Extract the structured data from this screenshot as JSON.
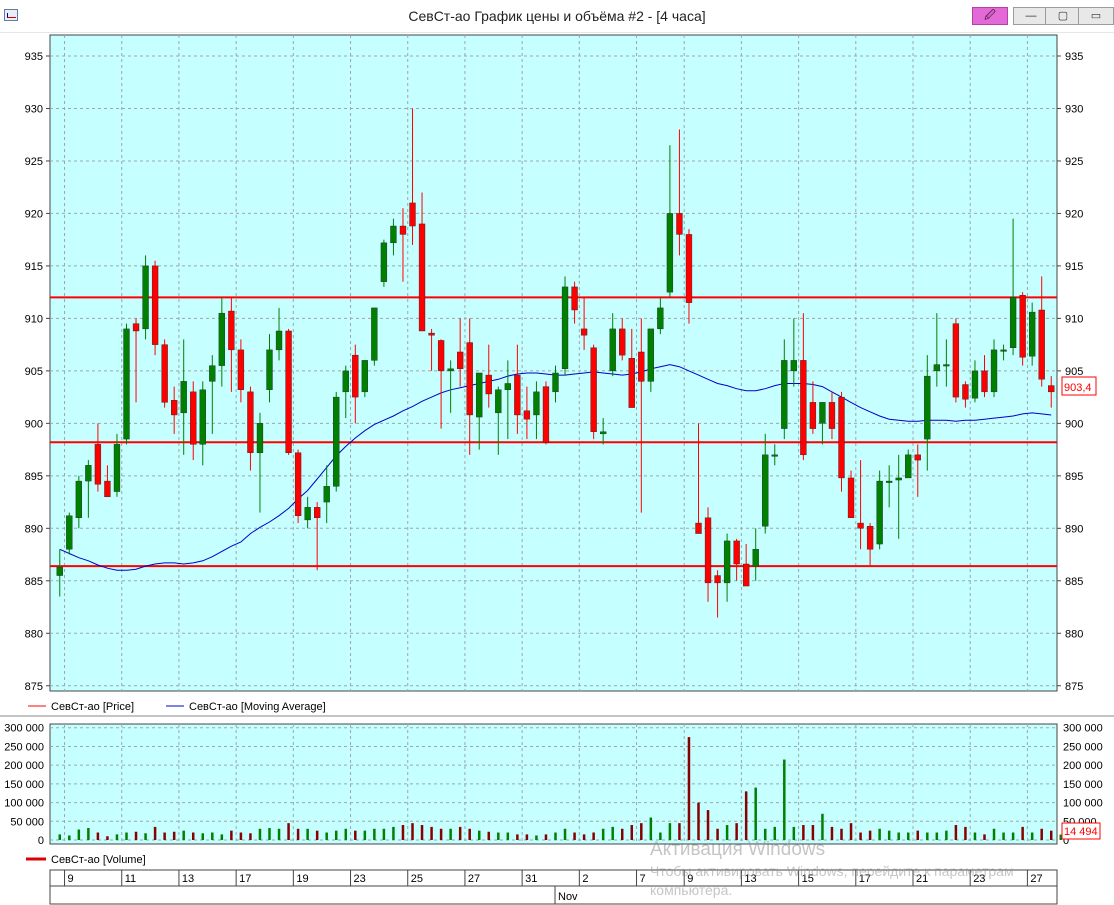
{
  "window": {
    "title": "СевСт-ао График цены и объёма #2 - [4 часа]",
    "buttons": {
      "pin": "🖉",
      "minimize": "—",
      "maximize": "▢",
      "close": "▭"
    }
  },
  "chart_data": [
    {
      "type": "candlestick",
      "series": [
        {
          "name": "СевСт-ао [Price]",
          "color": "#ff0000"
        },
        {
          "name": "СевСт-ао [Moving Average]",
          "color": "#0000cc"
        }
      ],
      "ylim": [
        874.5,
        937
      ],
      "yticks": [
        875,
        880,
        885,
        890,
        895,
        900,
        905,
        910,
        915,
        920,
        925,
        930,
        935
      ],
      "last_value_label": "903,4",
      "horizontal_levels": [
        912.0,
        898.2,
        886.4
      ],
      "candles": [
        {
          "o": 885.5,
          "h": 888.0,
          "l": 883.5,
          "c": 886.3
        },
        {
          "o": 888.0,
          "h": 891.5,
          "l": 887.5,
          "c": 891.2
        },
        {
          "o": 891.0,
          "h": 895.0,
          "l": 890.0,
          "c": 894.5
        },
        {
          "o": 894.5,
          "h": 896.5,
          "l": 891.0,
          "c": 896.0
        },
        {
          "o": 898.0,
          "h": 900.0,
          "l": 893.5,
          "c": 894.2
        },
        {
          "o": 894.5,
          "h": 896.0,
          "l": 893.0,
          "c": 893.0
        },
        {
          "o": 893.5,
          "h": 899.0,
          "l": 893.0,
          "c": 898.0
        },
        {
          "o": 898.5,
          "h": 909.5,
          "l": 898.0,
          "c": 909.0
        },
        {
          "o": 909.5,
          "h": 910.0,
          "l": 902.0,
          "c": 908.8
        },
        {
          "o": 909.0,
          "h": 916.0,
          "l": 908.0,
          "c": 915.0
        },
        {
          "o": 915.0,
          "h": 915.5,
          "l": 906.5,
          "c": 907.5
        },
        {
          "o": 907.5,
          "h": 908.0,
          "l": 901.5,
          "c": 902.0
        },
        {
          "o": 902.2,
          "h": 903.5,
          "l": 899.0,
          "c": 900.8
        },
        {
          "o": 901.0,
          "h": 908.0,
          "l": 897.0,
          "c": 904.0
        },
        {
          "o": 903.0,
          "h": 904.0,
          "l": 896.5,
          "c": 898.0
        },
        {
          "o": 898.0,
          "h": 904.0,
          "l": 896.0,
          "c": 903.2
        },
        {
          "o": 904.0,
          "h": 906.5,
          "l": 899.0,
          "c": 905.5
        },
        {
          "o": 905.5,
          "h": 912.0,
          "l": 903.5,
          "c": 910.5
        },
        {
          "o": 910.7,
          "h": 912.0,
          "l": 903.0,
          "c": 907.0
        },
        {
          "o": 907.0,
          "h": 908.0,
          "l": 902.0,
          "c": 903.2
        },
        {
          "o": 903.0,
          "h": 903.5,
          "l": 895.5,
          "c": 897.2
        },
        {
          "o": 897.2,
          "h": 901.0,
          "l": 891.5,
          "c": 900.0
        },
        {
          "o": 903.2,
          "h": 908.5,
          "l": 902.0,
          "c": 907.0
        },
        {
          "o": 907.0,
          "h": 911.0,
          "l": 906.0,
          "c": 908.8
        },
        {
          "o": 908.8,
          "h": 909.0,
          "l": 897.0,
          "c": 897.2
        },
        {
          "o": 897.2,
          "h": 897.5,
          "l": 890.5,
          "c": 891.2
        },
        {
          "o": 890.8,
          "h": 893.0,
          "l": 890.0,
          "c": 892.0
        },
        {
          "o": 892.0,
          "h": 892.5,
          "l": 886.0,
          "c": 891.0
        },
        {
          "o": 892.5,
          "h": 896.0,
          "l": 890.5,
          "c": 894.0
        },
        {
          "o": 894.0,
          "h": 903.0,
          "l": 893.5,
          "c": 902.5
        },
        {
          "o": 903.0,
          "h": 905.5,
          "l": 900.5,
          "c": 905.0
        },
        {
          "o": 906.5,
          "h": 907.5,
          "l": 900.0,
          "c": 902.5
        },
        {
          "o": 903.0,
          "h": 906.0,
          "l": 902.5,
          "c": 906.0
        },
        {
          "o": 906.0,
          "h": 911.0,
          "l": 905.5,
          "c": 911.0
        },
        {
          "o": 913.5,
          "h": 917.5,
          "l": 913.0,
          "c": 917.2
        },
        {
          "o": 917.2,
          "h": 919.5,
          "l": 916.0,
          "c": 918.8
        },
        {
          "o": 918.8,
          "h": 920.5,
          "l": 913.5,
          "c": 918.0
        },
        {
          "o": 921.0,
          "h": 930.0,
          "l": 917.0,
          "c": 918.8
        },
        {
          "o": 919.0,
          "h": 922.0,
          "l": 909.0,
          "c": 908.8
        },
        {
          "o": 908.6,
          "h": 909.0,
          "l": 905.0,
          "c": 908.4
        },
        {
          "o": 907.9,
          "h": 908.0,
          "l": 899.5,
          "c": 905.0
        },
        {
          "o": 905.0,
          "h": 906.0,
          "l": 901.0,
          "c": 905.2
        },
        {
          "o": 906.8,
          "h": 910.0,
          "l": 903.5,
          "c": 905.2
        },
        {
          "o": 907.7,
          "h": 910.0,
          "l": 897.0,
          "c": 900.8
        },
        {
          "o": 900.6,
          "h": 904.0,
          "l": 897.5,
          "c": 904.8
        },
        {
          "o": 904.6,
          "h": 907.5,
          "l": 901.5,
          "c": 902.8
        },
        {
          "o": 901.0,
          "h": 903.5,
          "l": 897.0,
          "c": 903.2
        },
        {
          "o": 903.2,
          "h": 906.0,
          "l": 898.5,
          "c": 903.8
        },
        {
          "o": 904.6,
          "h": 907.5,
          "l": 899.0,
          "c": 900.8
        },
        {
          "o": 901.2,
          "h": 903.5,
          "l": 898.5,
          "c": 900.4
        },
        {
          "o": 900.8,
          "h": 904.0,
          "l": 898.5,
          "c": 903.0
        },
        {
          "o": 903.5,
          "h": 904.0,
          "l": 898.0,
          "c": 898.2
        },
        {
          "o": 903.0,
          "h": 905.5,
          "l": 902.0,
          "c": 904.8
        },
        {
          "o": 905.2,
          "h": 914.0,
          "l": 904.6,
          "c": 913.0
        },
        {
          "o": 913.0,
          "h": 913.5,
          "l": 909.5,
          "c": 910.8
        },
        {
          "o": 909.0,
          "h": 912.0,
          "l": 907.0,
          "c": 908.4
        },
        {
          "o": 907.2,
          "h": 907.5,
          "l": 898.5,
          "c": 899.2
        },
        {
          "o": 899.0,
          "h": 900.5,
          "l": 898.0,
          "c": 899.2
        },
        {
          "o": 905.0,
          "h": 910.5,
          "l": 904.5,
          "c": 909.0
        },
        {
          "o": 909.0,
          "h": 910.0,
          "l": 906.0,
          "c": 906.5
        },
        {
          "o": 906.2,
          "h": 909.0,
          "l": 902.0,
          "c": 901.5
        },
        {
          "o": 906.8,
          "h": 910.0,
          "l": 891.5,
          "c": 904.0
        },
        {
          "o": 904.0,
          "h": 907.5,
          "l": 903.0,
          "c": 909.0
        },
        {
          "o": 909.0,
          "h": 912.0,
          "l": 908.5,
          "c": 911.0
        },
        {
          "o": 912.5,
          "h": 926.5,
          "l": 912.0,
          "c": 920.0
        },
        {
          "o": 920.0,
          "h": 928.0,
          "l": 916.0,
          "c": 918.0
        },
        {
          "o": 918.0,
          "h": 918.5,
          "l": 909.5,
          "c": 911.5
        },
        {
          "o": 890.5,
          "h": 900.0,
          "l": 889.5,
          "c": 889.5
        },
        {
          "o": 891.0,
          "h": 892.0,
          "l": 883.0,
          "c": 884.8
        },
        {
          "o": 885.5,
          "h": 886.0,
          "l": 881.5,
          "c": 884.8
        },
        {
          "o": 884.8,
          "h": 889.5,
          "l": 883.0,
          "c": 888.8
        },
        {
          "o": 888.8,
          "h": 889.0,
          "l": 885.0,
          "c": 886.6
        },
        {
          "o": 886.6,
          "h": 888.5,
          "l": 884.5,
          "c": 884.5
        },
        {
          "o": 886.4,
          "h": 890.0,
          "l": 885.0,
          "c": 888.0
        },
        {
          "o": 890.2,
          "h": 899.0,
          "l": 889.5,
          "c": 897.0
        },
        {
          "o": 897.0,
          "h": 898.0,
          "l": 896.0,
          "c": 897.0
        },
        {
          "o": 899.5,
          "h": 908.0,
          "l": 898.5,
          "c": 906.0
        },
        {
          "o": 905.0,
          "h": 910.0,
          "l": 903.5,
          "c": 906.0
        },
        {
          "o": 906.0,
          "h": 910.5,
          "l": 896.5,
          "c": 897.0
        },
        {
          "o": 902.0,
          "h": 904.0,
          "l": 899.0,
          "c": 899.5
        },
        {
          "o": 900.0,
          "h": 902.0,
          "l": 898.0,
          "c": 902.0
        },
        {
          "o": 902.0,
          "h": 903.0,
          "l": 898.5,
          "c": 899.5
        },
        {
          "o": 902.5,
          "h": 903.0,
          "l": 893.5,
          "c": 894.8
        },
        {
          "o": 894.8,
          "h": 895.5,
          "l": 891.0,
          "c": 891.0
        },
        {
          "o": 890.5,
          "h": 896.5,
          "l": 888.0,
          "c": 890.0
        },
        {
          "o": 890.2,
          "h": 890.5,
          "l": 886.5,
          "c": 888.0
        },
        {
          "o": 888.5,
          "h": 895.5,
          "l": 888.0,
          "c": 894.5
        },
        {
          "o": 894.5,
          "h": 896.0,
          "l": 892.0,
          "c": 894.5
        },
        {
          "o": 894.6,
          "h": 897.0,
          "l": 889.0,
          "c": 894.8
        },
        {
          "o": 894.8,
          "h": 897.5,
          "l": 895.0,
          "c": 897.0
        },
        {
          "o": 897.0,
          "h": 898.0,
          "l": 893.0,
          "c": 896.5
        },
        {
          "o": 898.5,
          "h": 906.5,
          "l": 895.5,
          "c": 904.5
        },
        {
          "o": 905.0,
          "h": 910.5,
          "l": 903.5,
          "c": 905.6
        },
        {
          "o": 905.6,
          "h": 908.0,
          "l": 903.5,
          "c": 905.6
        },
        {
          "o": 909.5,
          "h": 910.0,
          "l": 902.0,
          "c": 902.5
        },
        {
          "o": 903.7,
          "h": 904.0,
          "l": 901.5,
          "c": 902.3
        },
        {
          "o": 902.4,
          "h": 906.0,
          "l": 902.0,
          "c": 905.0
        },
        {
          "o": 905.0,
          "h": 906.5,
          "l": 902.5,
          "c": 903.0
        },
        {
          "o": 903.0,
          "h": 908.0,
          "l": 902.5,
          "c": 907.0
        },
        {
          "o": 907.0,
          "h": 907.5,
          "l": 906.0,
          "c": 907.0
        },
        {
          "o": 907.2,
          "h": 919.5,
          "l": 906.5,
          "c": 912.0
        },
        {
          "o": 912.2,
          "h": 912.5,
          "l": 905.5,
          "c": 906.3
        },
        {
          "o": 906.4,
          "h": 911.5,
          "l": 905.5,
          "c": 910.6
        },
        {
          "o": 910.8,
          "h": 914.0,
          "l": 903.5,
          "c": 904.2
        },
        {
          "o": 903.6,
          "h": 904.5,
          "l": 901.5,
          "c": 903.0
        }
      ],
      "moving_average": [
        888.0,
        887.6,
        887.2,
        886.9,
        886.5,
        886.2,
        886.0,
        886.0,
        886.1,
        886.4,
        886.6,
        886.7,
        886.7,
        886.6,
        886.7,
        886.9,
        887.3,
        887.8,
        888.3,
        888.7,
        889.5,
        890.1,
        890.6,
        891.2,
        891.9,
        892.8,
        893.6,
        894.7,
        895.8,
        896.9,
        897.8,
        898.6,
        899.3,
        899.9,
        900.3,
        900.7,
        901.2,
        901.6,
        902.1,
        902.5,
        902.9,
        903.2,
        903.4,
        903.6,
        903.8,
        904.0,
        904.2,
        904.5,
        904.7,
        904.8,
        904.8,
        904.7,
        904.6,
        904.6,
        904.7,
        904.8,
        904.9,
        904.8,
        904.7,
        904.6,
        904.7,
        904.9,
        905.2,
        905.4,
        905.6,
        905.4,
        905.0,
        904.6,
        904.2,
        903.8,
        903.6,
        903.3,
        903.1,
        903.1,
        903.3,
        903.6,
        903.8,
        903.8,
        903.8,
        903.7,
        903.5,
        903.0,
        902.5,
        902.0,
        901.5,
        901.1,
        900.7,
        900.4,
        900.3,
        900.2,
        900.2,
        900.3,
        900.3,
        900.3,
        900.2,
        900.3,
        900.3,
        900.4,
        900.5,
        900.6,
        900.7,
        900.9,
        901.0,
        900.9,
        900.8
      ],
      "volume": {
        "ylim": [
          0,
          310000
        ],
        "yticks": [
          0,
          50000,
          100000,
          150000,
          200000,
          250000,
          300000
        ],
        "ytick_labels": [
          "0",
          "50 000",
          "100 000",
          "150 000",
          "200 000",
          "250 000",
          "300 000"
        ],
        "last_value_label": "14 494",
        "values": [
          15000,
          12000,
          28000,
          32000,
          20000,
          10000,
          15000,
          20000,
          22000,
          18000,
          35000,
          20000,
          22000,
          25000,
          20000,
          18000,
          20000,
          15000,
          25000,
          20000,
          18000,
          30000,
          32000,
          30000,
          45000,
          30000,
          30000,
          25000,
          20000,
          25000,
          30000,
          25000,
          25000,
          30000,
          30000,
          35000,
          40000,
          45000,
          40000,
          35000,
          30000,
          30000,
          35000,
          30000,
          25000,
          22000,
          20000,
          20000,
          15000,
          15000,
          12000,
          15000,
          20000,
          30000,
          20000,
          15000,
          20000,
          30000,
          35000,
          30000,
          40000,
          45000,
          60000,
          20000,
          45000,
          45000,
          275000,
          100000,
          80000,
          30000,
          40000,
          45000,
          130000,
          140000,
          30000,
          35000,
          215000,
          35000,
          40000,
          40000,
          70000,
          35000,
          30000,
          45000,
          20000,
          25000,
          30000,
          25000,
          20000,
          20000,
          25000,
          20000,
          20000,
          25000,
          40000,
          35000,
          20000,
          15000,
          30000,
          20000,
          20000,
          35000,
          20000,
          30000,
          25000,
          14494
        ]
      }
    }
  ],
  "legend": {
    "price": "СевСт-ао [Price]",
    "ma": "СевСт-ао [Moving Average]",
    "volume": "СевСт-ао [Volume]"
  },
  "xaxis": {
    "day_labels": [
      "9",
      "11",
      "13",
      "17",
      "19",
      "23",
      "25",
      "27",
      "31",
      "2",
      "7",
      "9",
      "13",
      "15",
      "17",
      "21",
      "23",
      "27"
    ],
    "month_label": "Nov"
  },
  "watermark": {
    "line1": "Активация Windows",
    "line2": "Чтобы активировать Windows, перейдите к параметрам компьютера."
  },
  "colors": {
    "plot_bg": "#c6ffff",
    "up": "#008000",
    "down": "#ff0000",
    "level_line": "#ff0000",
    "ma_line": "#0000cc",
    "vol_up": "#008000",
    "vol_down": "#880000"
  }
}
